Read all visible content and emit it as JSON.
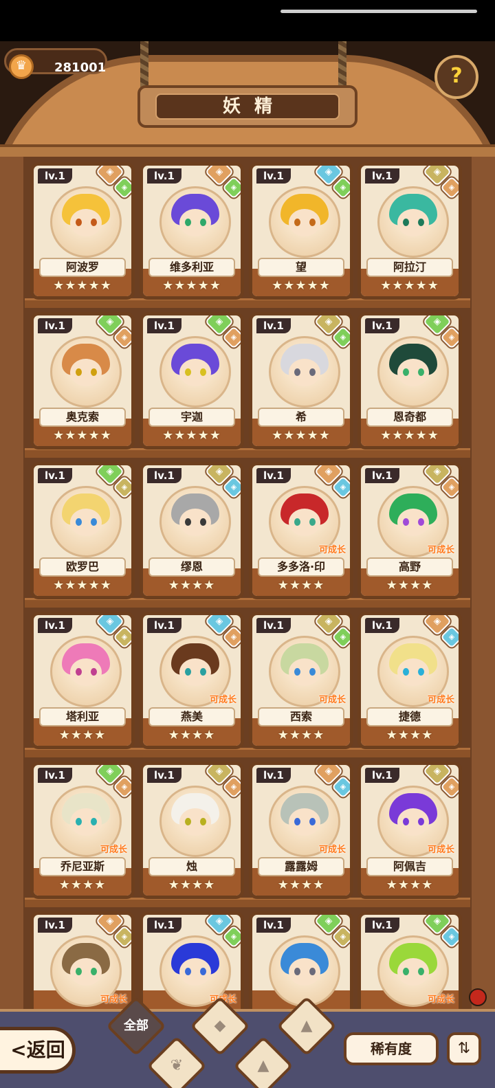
{
  "header": {
    "coins": "281001",
    "title": "妖精",
    "help_icon": "question-mark-leaf-icon"
  },
  "cards": [
    {
      "name": "阿波罗",
      "level": "lv.1",
      "stars": "★★★★★",
      "grow": "",
      "hair": "#f5c23a",
      "eye": "#c45a1a",
      "el1": "#e0a060",
      "el2": "#7fcf5a"
    },
    {
      "name": "维多利亚",
      "level": "lv.1",
      "stars": "★★★★★",
      "grow": "",
      "hair": "#6a4ad8",
      "eye": "#2fa86a",
      "el1": "#e0a060",
      "el2": "#7fcf5a"
    },
    {
      "name": "望",
      "level": "lv.1",
      "stars": "★★★★★",
      "grow": "",
      "hair": "#f1b62a",
      "eye": "#c46a1a",
      "el1": "#6ac7e0",
      "el2": "#7fcf5a"
    },
    {
      "name": "阿拉汀",
      "level": "lv.1",
      "stars": "★★★★★",
      "grow": "",
      "hair": "#3ab8a0",
      "eye": "#1e7a5a",
      "el1": "#c8b460",
      "el2": "#e0a060"
    },
    {
      "name": "奥克索",
      "level": "lv.1",
      "stars": "★★★★★",
      "grow": "",
      "hair": "#d88a48",
      "eye": "#d0a010",
      "el1": "#7fcf5a",
      "el2": "#e0a060"
    },
    {
      "name": "宇迦",
      "level": "lv.1",
      "stars": "★★★★★",
      "grow": "",
      "hair": "#6a4ad8",
      "eye": "#d8c020",
      "el1": "#7fcf5a",
      "el2": "#e0a060"
    },
    {
      "name": "希",
      "level": "lv.1",
      "stars": "★★★★★",
      "grow": "",
      "hair": "#d8d8de",
      "eye": "#6a6a7a",
      "el1": "#c8b460",
      "el2": "#7fcf5a"
    },
    {
      "name": "恩奇都",
      "level": "lv.1",
      "stars": "★★★★★",
      "grow": "",
      "hair": "#1f4a3a",
      "eye": "#3ab06a",
      "el1": "#7fcf5a",
      "el2": "#e0a060"
    },
    {
      "name": "欧罗巴",
      "level": "lv.1",
      "stars": "★★★★★",
      "grow": "",
      "hair": "#f3d470",
      "eye": "#3a8ad8",
      "el1": "#7fcf5a",
      "el2": "#c8b460"
    },
    {
      "name": "缪恩",
      "level": "lv.1",
      "stars": "★★★★",
      "grow": "",
      "hair": "#a8a8a8",
      "eye": "#3a3a3a",
      "el1": "#c8b460",
      "el2": "#6ac7e0"
    },
    {
      "name": "多多洛·印",
      "level": "lv.1",
      "stars": "★★★★",
      "grow": "可成长",
      "hair": "#c8282a",
      "eye": "#3aa88a",
      "el1": "#e0a060",
      "el2": "#6ac7e0"
    },
    {
      "name": "高野",
      "level": "lv.1",
      "stars": "★★★★",
      "grow": "可成长",
      "hair": "#2eae5a",
      "eye": "#a04ad8",
      "el1": "#c8b460",
      "el2": "#e0a060"
    },
    {
      "name": "塔利亚",
      "level": "lv.1",
      "stars": "★★★★",
      "grow": "",
      "hair": "#ee7ab8",
      "eye": "#c04090",
      "el1": "#6ac7e0",
      "el2": "#c8b460"
    },
    {
      "name": "燕美",
      "level": "lv.1",
      "stars": "★★★★",
      "grow": "可成长",
      "hair": "#6a3a1e",
      "eye": "#2aa0a0",
      "el1": "#6ac7e0",
      "el2": "#e0a060"
    },
    {
      "name": "西索",
      "level": "lv.1",
      "stars": "★★★★",
      "grow": "可成长",
      "hair": "#c8d8a0",
      "eye": "#3a8ad8",
      "el1": "#c8b460",
      "el2": "#7fcf5a"
    },
    {
      "name": "捷德",
      "level": "lv.1",
      "stars": "★★★★",
      "grow": "可成长",
      "hair": "#f1e08a",
      "eye": "#2ab0d8",
      "el1": "#e0a060",
      "el2": "#6ac7e0"
    },
    {
      "name": "乔尼亚斯",
      "level": "lv.1",
      "stars": "★★★★",
      "grow": "可成长",
      "hair": "#e8e4c8",
      "eye": "#2ab0b0",
      "el1": "#7fcf5a",
      "el2": "#e0a060"
    },
    {
      "name": "烛",
      "level": "lv.1",
      "stars": "★★★★",
      "grow": "",
      "hair": "#f4f1ea",
      "eye": "#b8b020",
      "el1": "#c8b460",
      "el2": "#e0a060"
    },
    {
      "name": "露露姆",
      "level": "lv.1",
      "stars": "★★★★",
      "grow": "可成长",
      "hair": "#b8c2b8",
      "eye": "#3a6ad8",
      "el1": "#e0a060",
      "el2": "#6ac7e0"
    },
    {
      "name": "阿佩吉",
      "level": "lv.1",
      "stars": "★★★★",
      "grow": "可成长",
      "hair": "#7a3ad8",
      "eye": "#7a3ad8",
      "el1": "#c8b460",
      "el2": "#e0a060"
    },
    {
      "name": "",
      "level": "lv.1",
      "stars": "",
      "grow": "可成长",
      "hair": "#8a6a44",
      "eye": "#3ab06a",
      "el1": "#e0a060",
      "el2": "#c8b460"
    },
    {
      "name": "",
      "level": "lv.1",
      "stars": "",
      "grow": "可成长",
      "hair": "#2a3ad8",
      "eye": "#3a6ad8",
      "el1": "#6ac7e0",
      "el2": "#7fcf5a"
    },
    {
      "name": "",
      "level": "lv.1",
      "stars": "",
      "grow": "",
      "hair": "#3a8ad8",
      "eye": "#6a6a7a",
      "el1": "#7fcf5a",
      "el2": "#c8b460"
    },
    {
      "name": "",
      "level": "lv.1",
      "stars": "",
      "grow": "可成长",
      "hair": "#9ad83a",
      "eye": "#3ab06a",
      "el1": "#7fcf5a",
      "el2": "#6ac7e0"
    }
  ],
  "bottom": {
    "back_label": "<返回",
    "filter_all": "全部",
    "rarity_label": "稀有度",
    "sort_icon": "sort-list-icon"
  }
}
